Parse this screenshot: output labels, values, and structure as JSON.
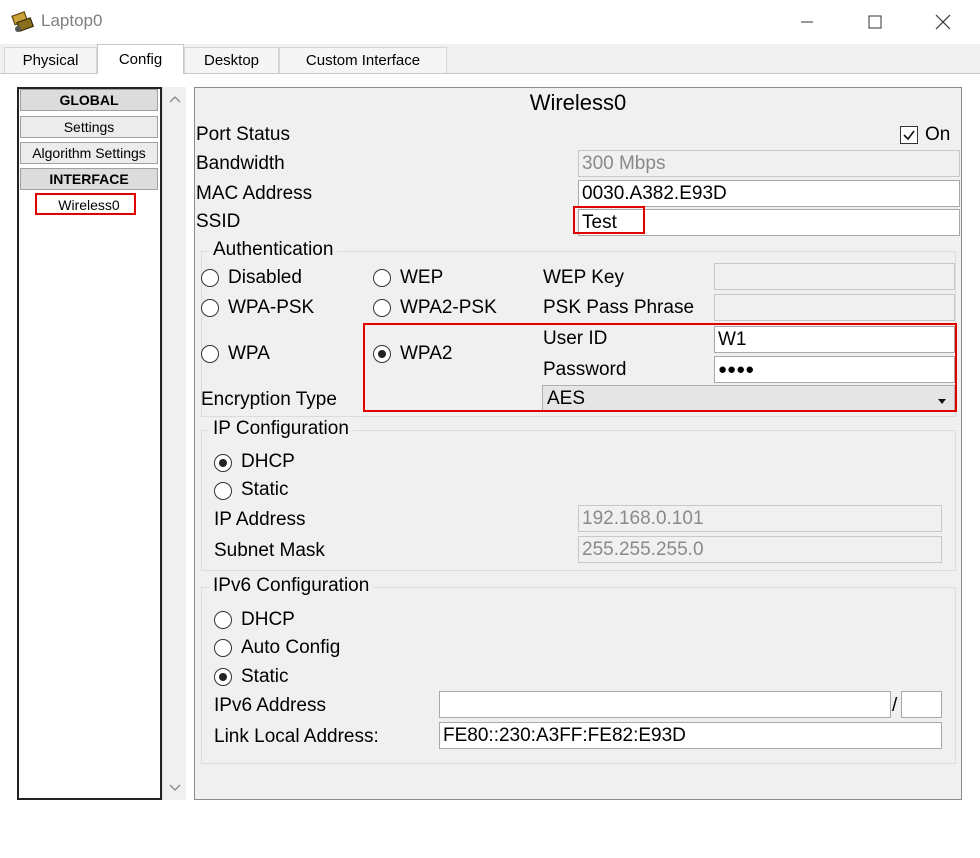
{
  "window": {
    "title": "Laptop0"
  },
  "tabs": [
    {
      "label": "Physical"
    },
    {
      "label": "Config"
    },
    {
      "label": "Desktop"
    },
    {
      "label": "Custom Interface"
    }
  ],
  "sidebar": {
    "global_header": "GLOBAL",
    "settings": "Settings",
    "algorithm_settings": "Algorithm Settings",
    "interface_header": "INTERFACE",
    "wireless0": "Wireless0"
  },
  "panel": {
    "title": "Wireless0",
    "port_status": {
      "label": "Port Status",
      "checkbox_label": "On",
      "checked": true
    },
    "bandwidth": {
      "label": "Bandwidth",
      "value": "300 Mbps"
    },
    "mac_address": {
      "label": "MAC Address",
      "value": "0030.A382.E93D"
    },
    "ssid": {
      "label": "SSID",
      "value": "Test"
    },
    "authentication": {
      "title": "Authentication",
      "disabled": "Disabled",
      "wep": "WEP",
      "wpa_psk": "WPA-PSK",
      "wpa2_psk": "WPA2-PSK",
      "wpa": "WPA",
      "wpa2": "WPA2",
      "selected": "WPA2",
      "wep_key_label": "WEP Key",
      "psk_pass_phrase_label": "PSK Pass Phrase",
      "user_id_label": "User ID",
      "user_id_value": "W1",
      "password_label": "Password",
      "password_value": "●●●●",
      "encryption_type_label": "Encryption Type",
      "encryption_type_value": "AES"
    },
    "ip_configuration": {
      "title": "IP Configuration",
      "dhcp": "DHCP",
      "static": "Static",
      "selected": "DHCP",
      "ip_address_label": "IP Address",
      "ip_address_value": "192.168.0.101",
      "subnet_mask_label": "Subnet Mask",
      "subnet_mask_value": "255.255.255.0"
    },
    "ipv6_configuration": {
      "title": "IPv6 Configuration",
      "dhcp": "DHCP",
      "auto_config": "Auto Config",
      "static": "Static",
      "selected": "Static",
      "ipv6_address_label": "IPv6 Address",
      "ipv6_address_value": "",
      "prefix_separator": "/",
      "prefix_value": "",
      "link_local_label": "Link Local Address:",
      "link_local_value": "FE80::230:A3FF:FE82:E93D"
    }
  },
  "colors": {
    "highlight": "#e00000",
    "panel_bg": "#f0f0f0"
  }
}
